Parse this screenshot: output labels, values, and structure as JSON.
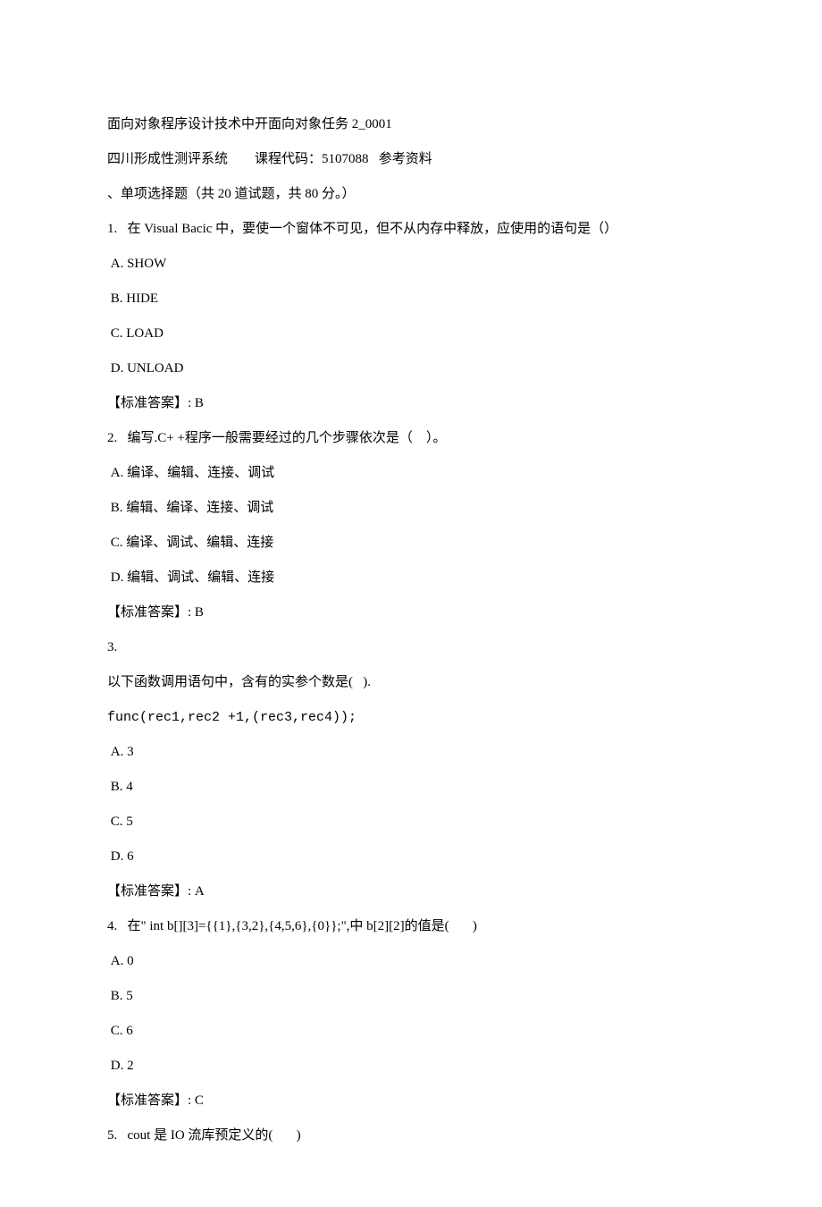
{
  "header": {
    "title": "面向对象程序设计技术中开面向对象任务 2_0001",
    "subtitle": "四川形成性测评系统        课程代码：5107088   参考资料",
    "section": "、单项选择题（共 20 道试题，共 80 分。）"
  },
  "questions": [
    {
      "num": "1.",
      "text": "在 Visual Bacic 中，要使一个窗体不可见，但不从内存中释放，应使用的语句是（）",
      "options": [
        "A. SHOW",
        "B. HIDE",
        "C. LOAD",
        "D. UNLOAD"
      ],
      "answer": "【标准答案】: B"
    },
    {
      "num": "2.",
      "text": "编写.C+ +程序一般需要经过的几个步骤依次是（    ）。",
      "options": [
        "A. 编译、编辑、连接、调试",
        "B. 编辑、编译、连接、调试",
        "C. 编译、调试、编辑、连接",
        "D. 编辑、调试、编辑、连接"
      ],
      "answer": "【标准答案】: B"
    },
    {
      "num": "3.",
      "text": "",
      "extra": [
        "以下函数调用语句中，含有的实参个数是(   ).",
        "func(rec1,rec2 +1,(rec3,rec4));"
      ],
      "options": [
        "A. 3",
        "B. 4",
        "C. 5",
        "D. 6"
      ],
      "answer": "【标准答案】: A"
    },
    {
      "num": "4.",
      "text": "在\" int b[][3]={{1},{3,2},{4,5,6},{0}};\",中 b[2][2]的值是(       )",
      "options": [
        "A. 0",
        "B. 5",
        "C. 6",
        "D. 2"
      ],
      "answer": "【标准答案】: C"
    },
    {
      "num": "5.",
      "text": "cout 是 IO 流库预定义的(       )",
      "options": [],
      "answer": ""
    }
  ]
}
